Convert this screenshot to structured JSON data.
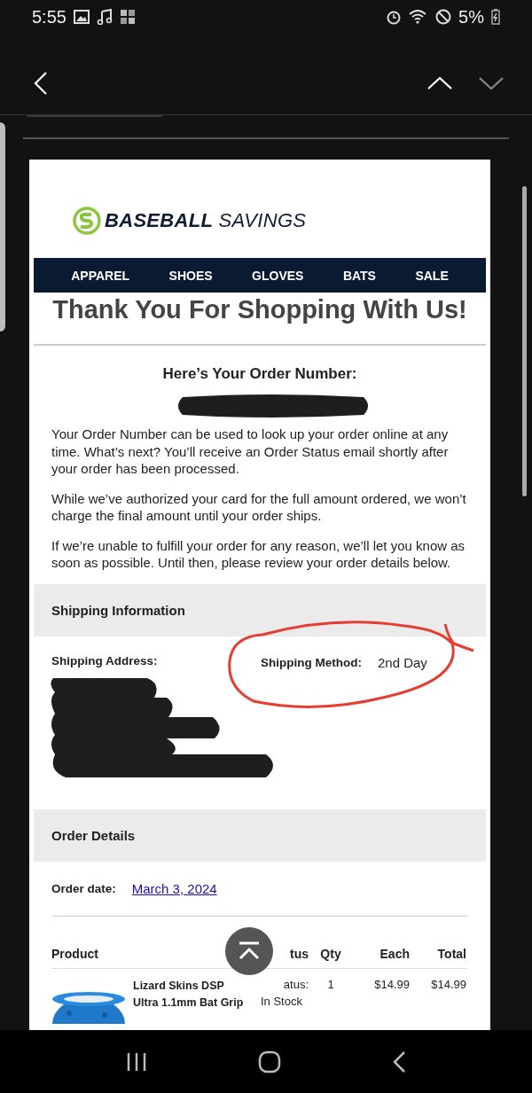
{
  "status_bar": {
    "time": "5:55",
    "battery": "5%"
  },
  "email": {
    "brand": {
      "bold": "BASEBALL",
      "light": "SAVINGS"
    },
    "nav": [
      "APPAREL",
      "SHOES",
      "GLOVES",
      "BATS",
      "SALE"
    ],
    "heading": "Thank You For Shopping With Us!",
    "order_number_label": "Here’s Your Order Number:",
    "paragraphs": [
      "Your Order Number can be used to look up your order online at any time. What’s next? You’ll receive an Order Status email shortly after your order has been processed.",
      "While we’ve authorized your card for the full amount ordered, we won’t charge the final amount until your order ships.",
      "If we’re unable to fulfill your order for any reason, we’ll let you know as soon as possible. Until then, please review your order details below."
    ],
    "shipping": {
      "title": "Shipping Information",
      "address_label": "Shipping Address:",
      "method_label": "Shipping Method:",
      "method": "2nd Day"
    },
    "order_details": {
      "title": "Order Details",
      "date_label": "Order date:",
      "date": "March 3, 2024",
      "columns": [
        "Product",
        "tus",
        "Qty",
        "Each",
        "Total"
      ],
      "rows": [
        {
          "product": "Lizard Skins DSP Ultra 1.1mm Bat Grip",
          "status_label": "atus:",
          "status": "In Stock",
          "qty": "1",
          "each": "$14.99",
          "total": "$14.99"
        }
      ]
    }
  }
}
